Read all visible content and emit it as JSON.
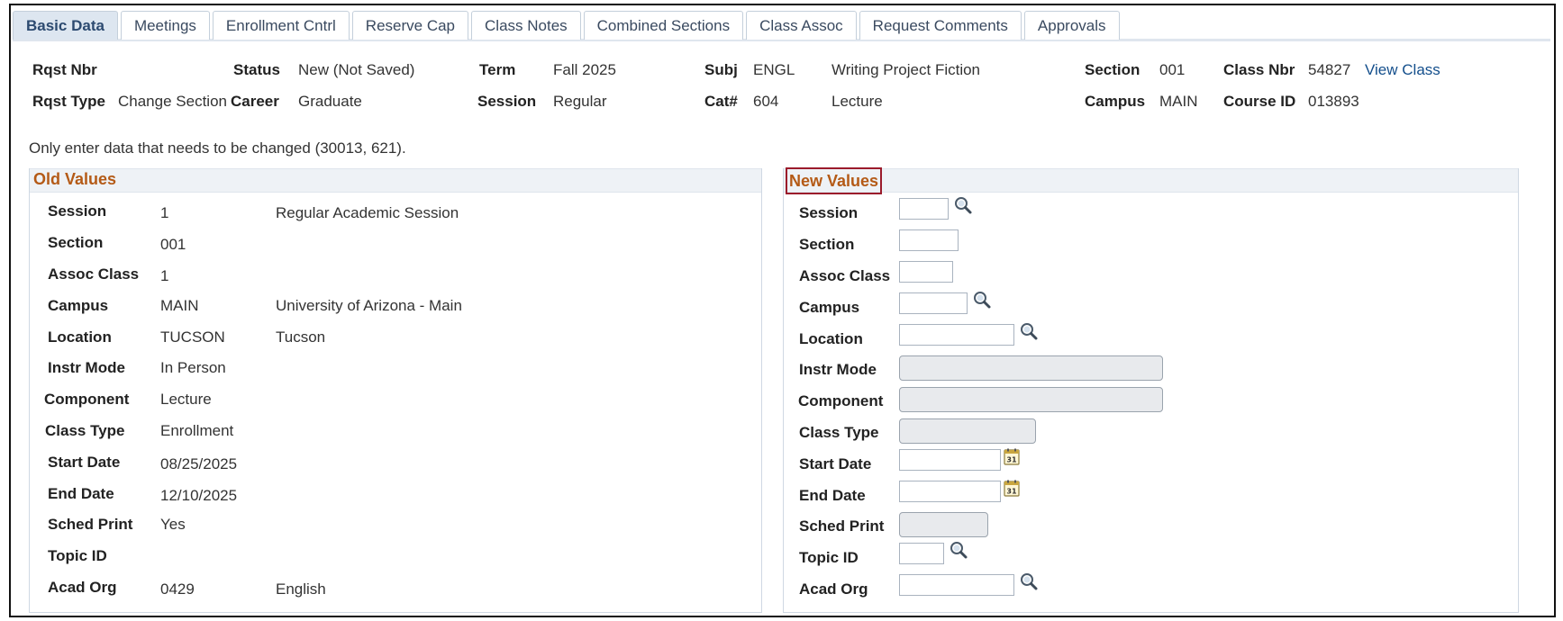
{
  "tabs": [
    {
      "label": "Basic Data",
      "active": true
    },
    {
      "label": "Meetings"
    },
    {
      "label": "Enrollment Cntrl"
    },
    {
      "label": "Reserve Cap"
    },
    {
      "label": "Class Notes"
    },
    {
      "label": "Combined Sections"
    },
    {
      "label": "Class Assoc"
    },
    {
      "label": "Request Comments"
    },
    {
      "label": "Approvals"
    }
  ],
  "header": {
    "rqst_nbr_label": "Rqst Nbr",
    "rqst_type_label": "Rqst Type",
    "rqst_type_value": "Change Section",
    "status_label": "Status",
    "status_value": "New (Not Saved)",
    "career_label": "Career",
    "career_value": "Graduate",
    "term_label": "Term",
    "term_value": "Fall 2025",
    "session_label": "Session",
    "session_value": "Regular",
    "subj_label": "Subj",
    "subj_value": "ENGL",
    "course_title": "Writing Project Fiction",
    "cat_label": "Cat#",
    "cat_value": "604",
    "component": "Lecture",
    "section_label": "Section",
    "section_value": "001",
    "campus_label": "Campus",
    "campus_value": "MAIN",
    "class_nbr_label": "Class Nbr",
    "class_nbr_value": "54827",
    "view_class_link": "View Class",
    "course_id_label": "Course ID",
    "course_id_value": "013893"
  },
  "note": "Only enter data that needs to be changed (30013, 621).",
  "old_values": {
    "title": "Old Values",
    "rows": [
      {
        "label": "Session",
        "value": "1",
        "desc": "Regular Academic Session"
      },
      {
        "label": "Section",
        "value": "001",
        "desc": ""
      },
      {
        "label": "Assoc Class",
        "value": "1",
        "desc": ""
      },
      {
        "label": "Campus",
        "value": "MAIN",
        "desc": "University of Arizona - Main"
      },
      {
        "label": "Location",
        "value": "TUCSON",
        "desc": "Tucson"
      },
      {
        "label": "Instr Mode",
        "value": "In Person",
        "desc": ""
      },
      {
        "label": "Component",
        "value": "Lecture",
        "desc": ""
      },
      {
        "label": "Class Type",
        "value": "Enrollment",
        "desc": ""
      },
      {
        "label": "Start Date",
        "value": "08/25/2025",
        "desc": ""
      },
      {
        "label": "End Date",
        "value": "12/10/2025",
        "desc": ""
      },
      {
        "label": "Sched Print",
        "value": "Yes",
        "desc": ""
      },
      {
        "label": "Topic ID",
        "value": "",
        "desc": ""
      },
      {
        "label": "Acad Org",
        "value": "0429",
        "desc": "English"
      }
    ]
  },
  "new_values": {
    "title": "New Values",
    "rows": [
      {
        "label": "Session",
        "control": "input-lookup",
        "value": ""
      },
      {
        "label": "Section",
        "control": "input",
        "value": ""
      },
      {
        "label": "Assoc Class",
        "control": "input",
        "value": ""
      },
      {
        "label": "Campus",
        "control": "input-lookup",
        "value": ""
      },
      {
        "label": "Location",
        "control": "input-lookup",
        "value": ""
      },
      {
        "label": "Instr Mode",
        "control": "select",
        "value": ""
      },
      {
        "label": "Component",
        "control": "select",
        "value": ""
      },
      {
        "label": "Class Type",
        "control": "select",
        "value": ""
      },
      {
        "label": "Start Date",
        "control": "input-calendar",
        "value": ""
      },
      {
        "label": "End Date",
        "control": "input-calendar",
        "value": ""
      },
      {
        "label": "Sched Print",
        "control": "select",
        "value": ""
      },
      {
        "label": "Topic ID",
        "control": "input-lookup",
        "value": ""
      },
      {
        "label": "Acad Org",
        "control": "input-lookup",
        "value": ""
      }
    ]
  },
  "icons": {
    "lookup": "magnifier-lookup-icon",
    "calendar": "calendar-icon",
    "dropdown": "chevron-down-icon"
  },
  "colors": {
    "panel_title": "#b45a16",
    "highlight_box": "#9b1b2b",
    "link": "#144f8c",
    "active_tab_bg": "#dde6f0"
  }
}
